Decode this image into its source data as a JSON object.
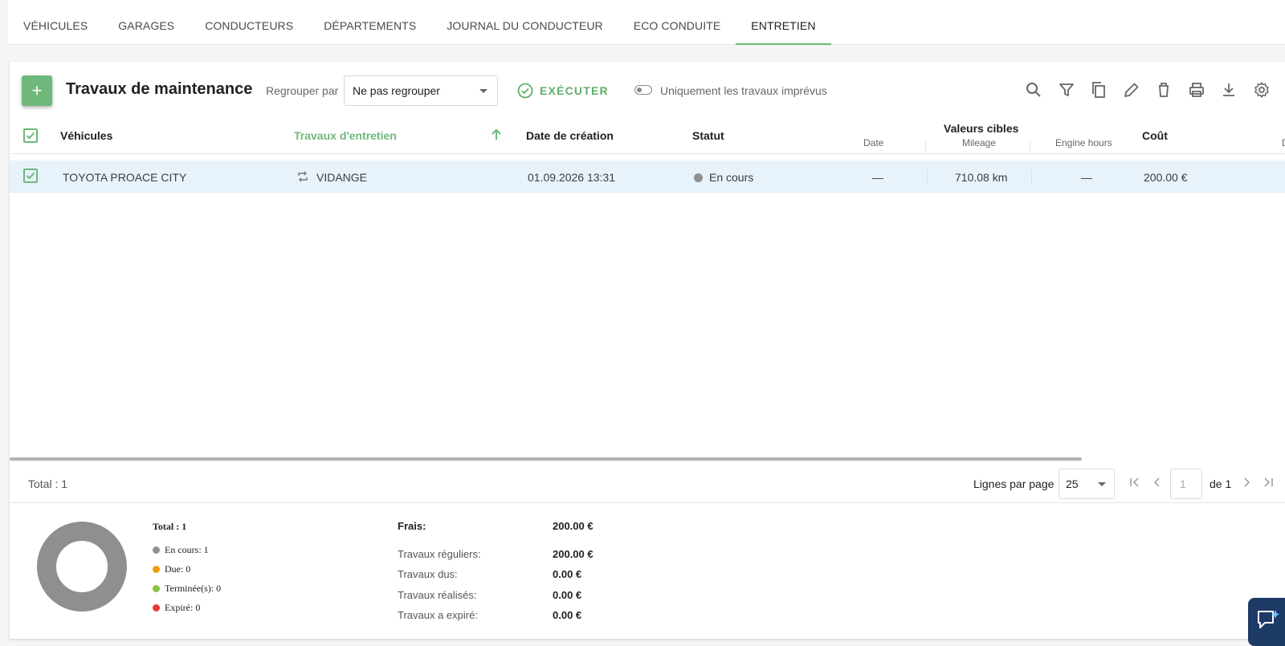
{
  "tabs": [
    {
      "label": "VÉHICULES"
    },
    {
      "label": "GARAGES"
    },
    {
      "label": "CONDUCTEURS"
    },
    {
      "label": "DÉPARTEMENTS"
    },
    {
      "label": "JOURNAL DU CONDUCTEUR"
    },
    {
      "label": "ECO CONDUITE"
    },
    {
      "label": "ENTRETIEN",
      "active": true
    }
  ],
  "toolbar": {
    "add_label": "+",
    "title": "Travaux de maintenance",
    "group_label": "Regrouper par",
    "group_value": "Ne pas regrouper",
    "execute_label": "EXÉCUTER",
    "toggle_label": "Uniquement les travaux imprévus",
    "icons": [
      "search-icon",
      "filter-icon",
      "copy-icon",
      "edit-icon",
      "delete-icon",
      "print-icon",
      "download-icon",
      "settings-icon"
    ]
  },
  "table": {
    "headers": {
      "vehicles": "Véhicules",
      "maintenance": "Travaux d'entretien",
      "created": "Date de création",
      "status": "Statut",
      "target_group": "Valeurs cibles",
      "target_date": "Date",
      "target_mileage": "Mileage",
      "target_engine": "Engine hours",
      "cost": "Coût",
      "cut_off": "D"
    },
    "rows": [
      {
        "vehicle": "TOYOTA PROACE CITY",
        "maintenance": "VIDANGE",
        "created": "01.09.2026 13:31",
        "status": "En cours",
        "date": "—",
        "mileage": "710.08 km",
        "engine_hours": "—",
        "cost": "200.00 €"
      }
    ]
  },
  "footer": {
    "total": "Total : 1",
    "rows_per_page_label": "Lignes par page",
    "rows_per_page": "25",
    "page": "1",
    "page_of": "de 1"
  },
  "summary": {
    "legend_total": "Total : 1",
    "legend": [
      {
        "label": "En cours: 1",
        "color": "#8f8f8f"
      },
      {
        "label": "Due: 0",
        "color": "#f39c12"
      },
      {
        "label": "Terminée(s): 0",
        "color": "#8bc34a"
      },
      {
        "label": "Expiré: 0",
        "color": "#e53935"
      }
    ],
    "costs": [
      {
        "label": "Frais:",
        "value": "200.00 €"
      },
      {
        "label": "Travaux réguliers:",
        "value": "200.00 €"
      },
      {
        "label": "Travaux dus:",
        "value": "0.00 €"
      },
      {
        "label": "Travaux réalisés:",
        "value": "0.00 €"
      },
      {
        "label": "Travaux a expiré:",
        "value": "0.00 €"
      }
    ]
  },
  "colors": {
    "accent": "#6fb87b",
    "row_selected": "#e7f2fb",
    "status_in_progress": "#8f8f8f",
    "chat_button": "#1e3a66"
  }
}
